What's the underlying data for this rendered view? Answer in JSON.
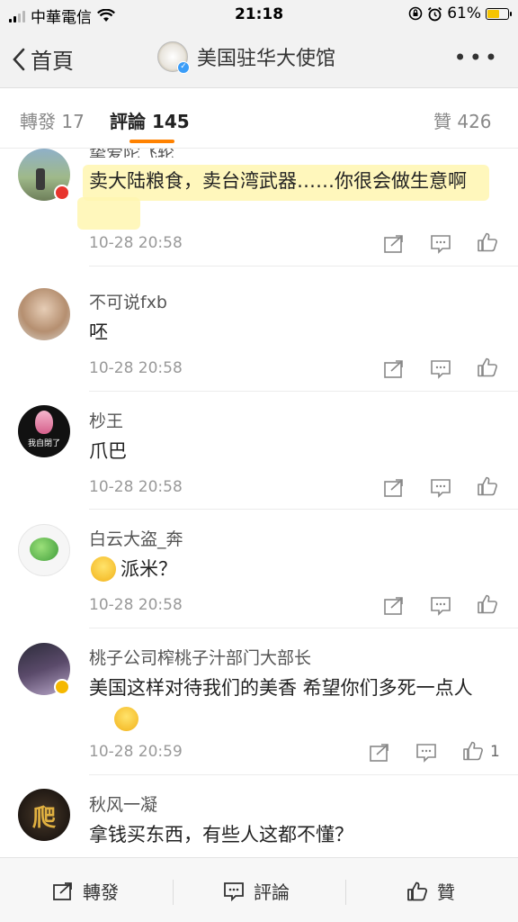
{
  "status_bar": {
    "carrier": "中華電信",
    "time": "21:18",
    "battery": "61%",
    "battery_level": 0.61
  },
  "nav": {
    "back_label": "首頁",
    "title": "美国驻华大使馆"
  },
  "tabs": {
    "repost": "轉發 17",
    "comment": "評論 145",
    "like": "贊 426"
  },
  "comments": [
    {
      "user": "挚爱陀飞轮",
      "text": "卖大陆粮食，卖台湾武器……你很会做生意啊",
      "time": "10-28 20:58",
      "likes": ""
    },
    {
      "user": "不可说fxb",
      "text": "呸",
      "time": "10-28 20:58",
      "likes": ""
    },
    {
      "user": "杪王",
      "text": "爪巴",
      "time": "10-28 20:58",
      "likes": "",
      "avatar_text": "我自閉了"
    },
    {
      "user": "白云大盗_奔",
      "text": "派米？",
      "time": "10-28 20:58",
      "likes": ""
    },
    {
      "user": "桃子公司榨桃子汁部门大部长",
      "text": "美国这样对待我们的美香 希望你们多死一点人",
      "time": "10-28 20:59",
      "likes": "1"
    },
    {
      "user": "秋风一凝",
      "text": "拿钱买东西，有些人这都不懂？",
      "time": "",
      "likes": ""
    }
  ],
  "bottom_bar": {
    "repost": "轉發",
    "comment": "評論",
    "like": "贊"
  },
  "colors": {
    "accent": "#ff8200",
    "highlight": "#fff6b0",
    "verified": "#3a9df8"
  }
}
